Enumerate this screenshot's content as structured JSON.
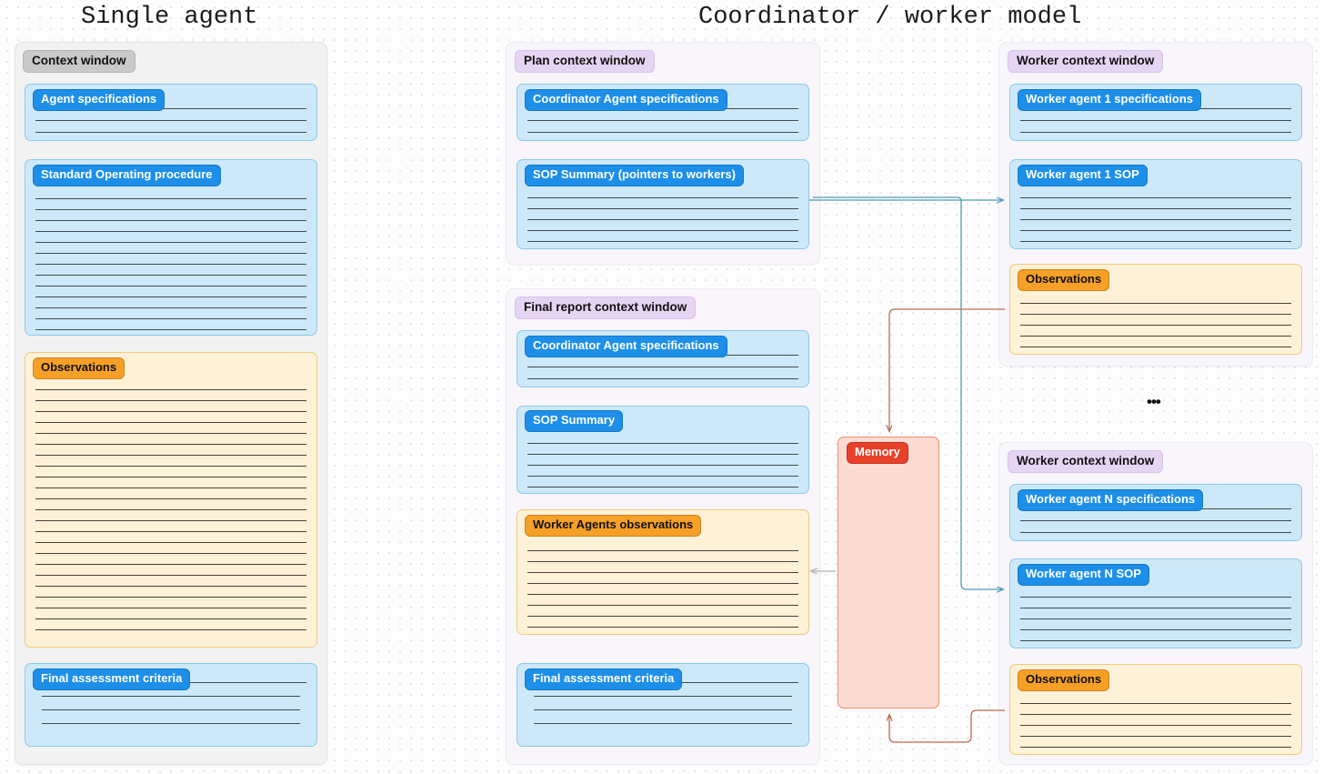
{
  "titles": {
    "left": "Single agent",
    "right": "Coordinator / worker model"
  },
  "colors": {
    "accent_blue": "#1e8fe8",
    "card_blue_bg": "#cde9f9",
    "accent_orange": "#f6a028",
    "card_cream_bg": "#fdf1d8",
    "accent_red": "#e8412a",
    "card_pink_bg": "#fcdcd2",
    "chip_lilac": "#e6d5f2",
    "chip_grey": "#c9c9c9",
    "panel_grey_bg": "#f2f2f2",
    "panel_lilac_bg": "#f8f5fb",
    "wire_blue": "#4e9ab5",
    "wire_red": "#bd6a52",
    "wire_grey": "#b6b0b6"
  },
  "single_agent_panel": {
    "chip": "Context window",
    "cards": [
      {
        "label": "Agent specifications",
        "kind": "blue",
        "lines": 3
      },
      {
        "label": "Standard Operating procedure",
        "kind": "blue",
        "lines": 13
      },
      {
        "label": "Observations",
        "kind": "cream",
        "lines": 23
      },
      {
        "label": "Final assessment criteria",
        "kind": "blue",
        "lines": 4,
        "label_overlaps_first_line": true
      }
    ]
  },
  "plan_context_panel": {
    "chip": "Plan context window",
    "cards": [
      {
        "label": "Coordinator Agent specifications",
        "kind": "blue",
        "lines": 3
      },
      {
        "label": "SOP Summary (pointers to workers)",
        "kind": "blue",
        "lines": 5
      }
    ]
  },
  "final_report_panel": {
    "chip": "Final report context window",
    "cards": [
      {
        "label": "Coordinator Agent specifications",
        "kind": "blue",
        "lines": 3
      },
      {
        "label": "SOP Summary",
        "kind": "blue",
        "lines": 5
      },
      {
        "label": "Worker Agents observations",
        "kind": "cream",
        "lines": 8
      },
      {
        "label": "Final assessment criteria",
        "kind": "blue",
        "lines": 4,
        "label_overlaps_first_line": true
      }
    ]
  },
  "memory": {
    "label": "Memory"
  },
  "worker_panel_1": {
    "chip": "Worker context window",
    "cards": [
      {
        "label": "Worker agent 1 specifications",
        "kind": "blue",
        "lines": 3
      },
      {
        "label": "Worker agent 1 SOP",
        "kind": "blue",
        "lines": 5
      },
      {
        "label": "Observations",
        "kind": "cream",
        "lines": 5
      }
    ]
  },
  "worker_panel_n": {
    "chip": "Worker context window",
    "cards": [
      {
        "label": "Worker agent N specifications",
        "kind": "blue",
        "lines": 3
      },
      {
        "label": "Worker agent N SOP",
        "kind": "blue",
        "lines": 5
      },
      {
        "label": "Observations",
        "kind": "cream",
        "lines": 5
      }
    ]
  },
  "ellipsis": "•••",
  "connections": [
    {
      "from": "SOP Summary (pointers to workers)",
      "to": "Worker agent 1 SOP",
      "color": "#4e9ab5"
    },
    {
      "from": "SOP Summary (pointers to workers)",
      "to": "Worker agent N SOP",
      "color": "#4e9ab5"
    },
    {
      "from": "Observations (worker 1)",
      "to": "Memory",
      "color": "#bd6a52"
    },
    {
      "from": "Observations (worker N)",
      "to": "Memory",
      "color": "#bd6a52"
    },
    {
      "from": "Memory",
      "to": "Worker Agents observations",
      "color": "#b6b0b6"
    }
  ]
}
